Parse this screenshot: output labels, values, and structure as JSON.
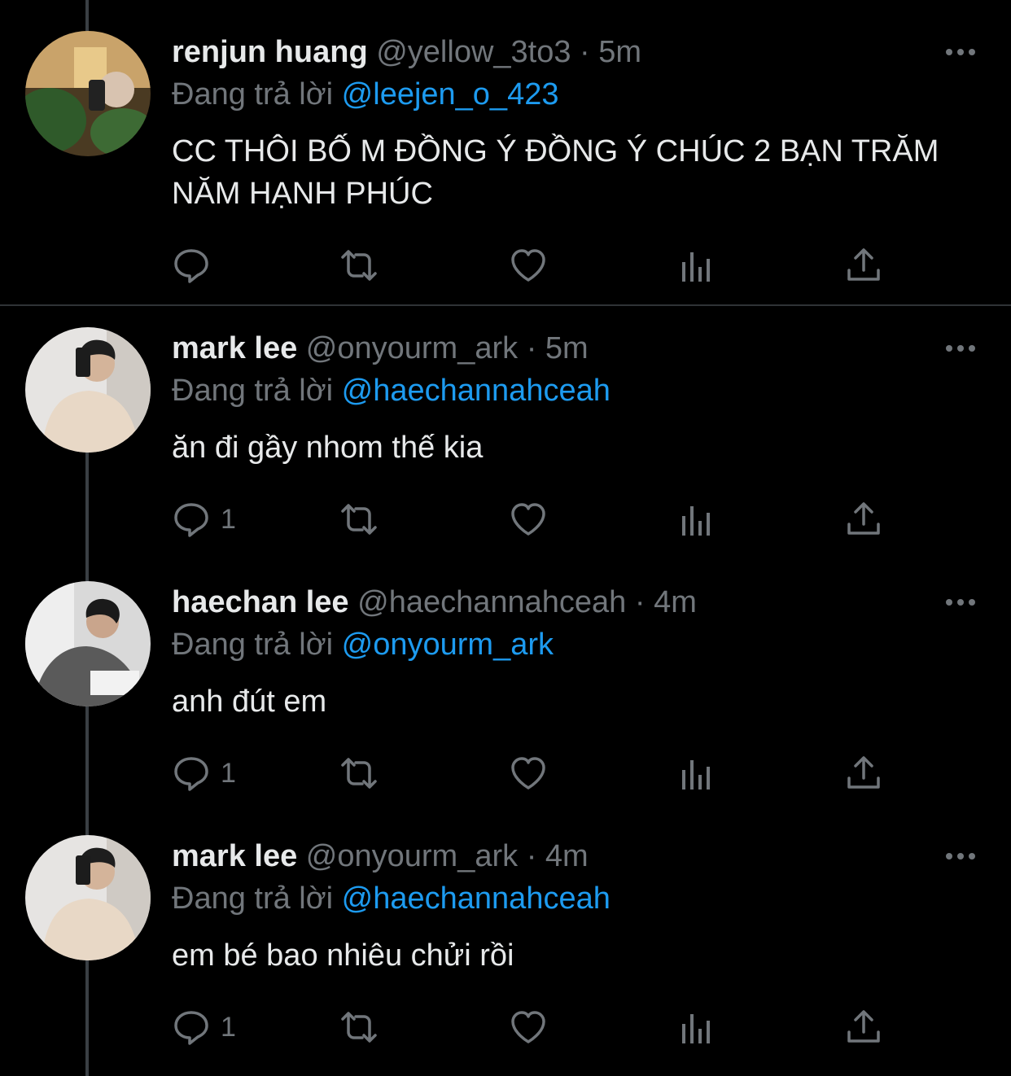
{
  "colors": {
    "background": "#000000",
    "text": "#e7e9ea",
    "muted": "#71767b",
    "link": "#1d9bf0",
    "divider": "#2f3336"
  },
  "replying_prefix": "Đang trả lời",
  "tweets": [
    {
      "name": "renjun huang",
      "handle": "@yellow_3to3",
      "separator": "·",
      "time": "5m",
      "reply_to": "@leejen_o_423",
      "text": "CC THÔI BỐ M ĐỒNG Ý ĐỒNG Ý CHÚC 2 BẠN TRĂM NĂM HẠNH PHÚC",
      "reply_count": ""
    },
    {
      "name": "mark lee",
      "handle": "@onyourm_ark",
      "separator": "·",
      "time": "5m",
      "reply_to": "@haechannahceah",
      "text": "ăn đi gầy nhom thế kia",
      "reply_count": "1"
    },
    {
      "name": "haechan lee",
      "handle": "@haechannahceah",
      "separator": "·",
      "time": "4m",
      "reply_to": "@onyourm_ark",
      "text": "anh đút em",
      "reply_count": "1"
    },
    {
      "name": "mark lee",
      "handle": "@onyourm_ark",
      "separator": "·",
      "time": "4m",
      "reply_to": "@haechannahceah",
      "text": "em bé bao nhiêu chửi rồi",
      "reply_count": "1"
    }
  ],
  "icons": {
    "more": "more-horizontal-icon",
    "reply": "reply-bubble-icon",
    "retweet": "retweet-icon",
    "like": "heart-icon",
    "views": "views-bar-chart-icon",
    "share": "share-upload-icon"
  }
}
